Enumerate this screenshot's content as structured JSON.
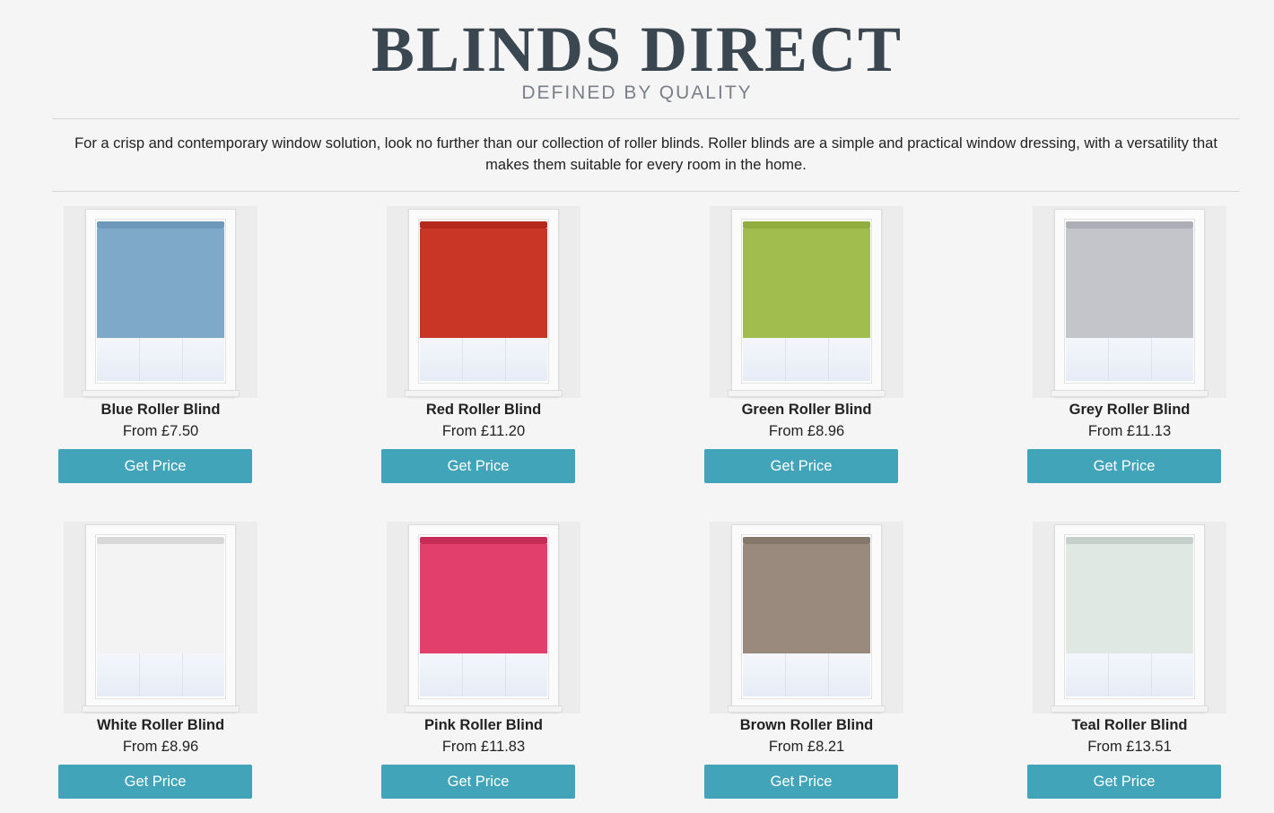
{
  "header": {
    "logo": "BLINDS DIRECT",
    "tagline": "DEFINED BY QUALITY"
  },
  "intro": "For a crisp and contemporary window solution, look no further than our collection of roller blinds. Roller blinds are a simple and practical window dressing, with a versatility that makes them suitable for every room in the home.",
  "button_label": "Get Price",
  "products": [
    {
      "name": "Blue Roller Blind",
      "price": "From £7.50",
      "color": "#7fa9c9",
      "bar": "#6c98ba"
    },
    {
      "name": "Red Roller Blind",
      "price": "From £11.20",
      "color": "#c93626",
      "bar": "#b52a1c"
    },
    {
      "name": "Green Roller Blind",
      "price": "From £8.96",
      "color": "#a0bd4e",
      "bar": "#8fae3f"
    },
    {
      "name": "Grey Roller Blind",
      "price": "From £11.13",
      "color": "#c4c4cb",
      "bar": "#aeaeb6"
    },
    {
      "name": "White Roller Blind",
      "price": "From £8.96",
      "color": "#f3f3f3",
      "bar": "#d8d8d8"
    },
    {
      "name": "Pink Roller Blind",
      "price": "From £11.83",
      "color": "#e23f6c",
      "bar": "#c72c57"
    },
    {
      "name": "Brown Roller Blind",
      "price": "From £8.21",
      "color": "#9a8a7e",
      "bar": "#86776b"
    },
    {
      "name": "Teal Roller Blind",
      "price": "From £13.51",
      "color": "#dfe8e3",
      "bar": "#c6d0cb"
    }
  ]
}
